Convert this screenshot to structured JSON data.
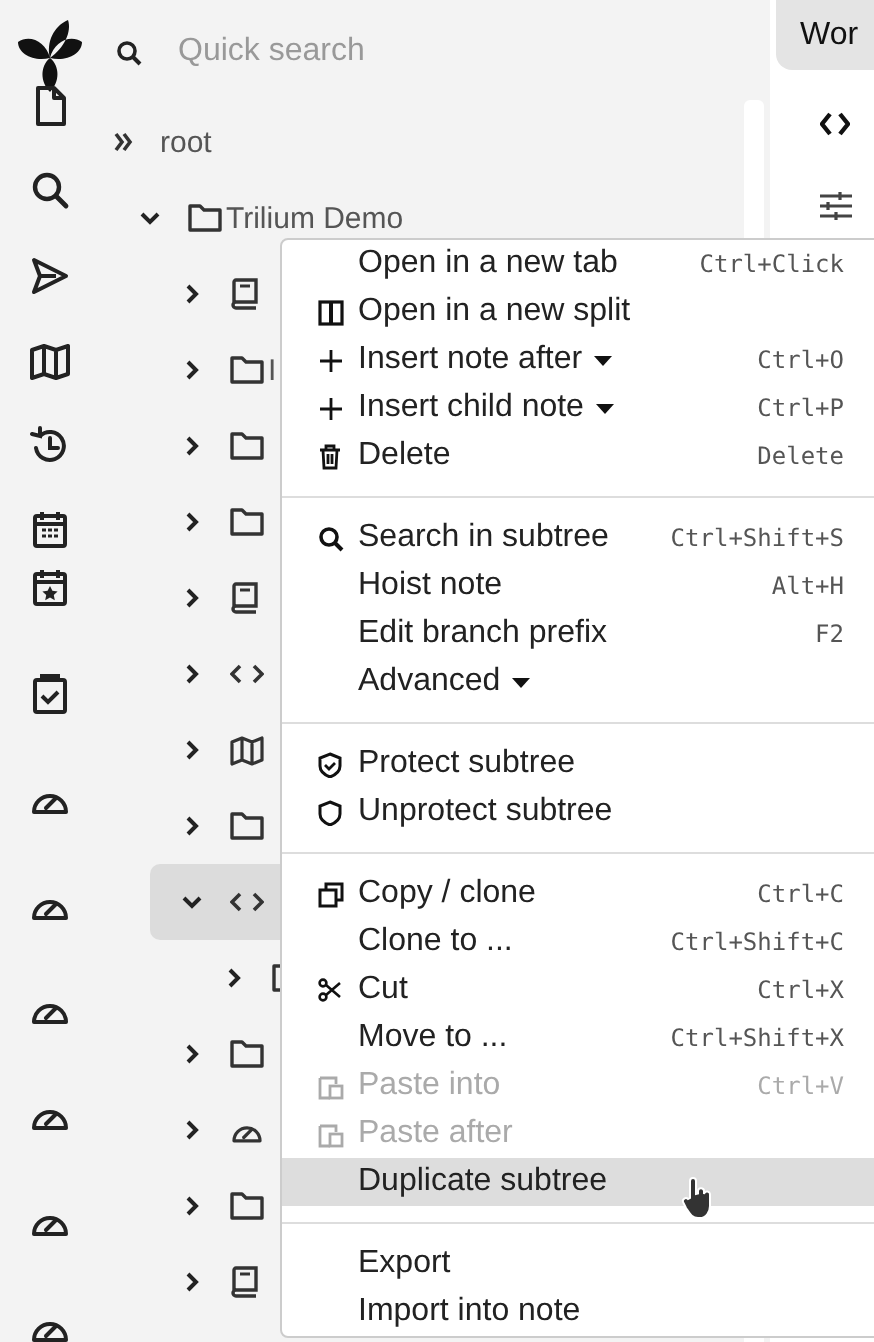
{
  "search": {
    "placeholder": "Quick search"
  },
  "tab": {
    "label": "Wor"
  },
  "tree": [
    {
      "label": "root",
      "selected": false,
      "children": [
        {
          "label": "Trilium Demo",
          "expanded": true,
          "selected": false,
          "children": [
            {
              "expanded": false,
              "selected": false
            },
            {
              "label": "I",
              "expanded": false,
              "selected": false
            },
            {
              "expanded": false,
              "selected": false
            },
            {
              "expanded": false,
              "selected": false
            },
            {
              "expanded": false,
              "selected": false
            },
            {
              "expanded": false,
              "selected": false
            },
            {
              "expanded": false,
              "selected": false
            },
            {
              "expanded": false,
              "selected": false
            },
            {
              "expanded": true,
              "selected": true,
              "children": [
                {
                  "expanded": false,
                  "selected": false
                }
              ]
            },
            {
              "expanded": false,
              "selected": false
            },
            {
              "expanded": false,
              "selected": false
            },
            {
              "expanded": false,
              "selected": false
            },
            {
              "expanded": false,
              "selected": false
            }
          ]
        }
      ]
    }
  ],
  "menu": {
    "groups": [
      [
        {
          "label": "Open in a new tab",
          "shortcut": "Ctrl+Click",
          "submenu": false,
          "disabled": false,
          "highlighted": false
        },
        {
          "label": "Open in a new split",
          "submenu": false,
          "disabled": false,
          "highlighted": false
        },
        {
          "label": "Insert note after",
          "shortcut": "Ctrl+O",
          "submenu": true,
          "disabled": false,
          "highlighted": false
        },
        {
          "label": "Insert child note",
          "shortcut": "Ctrl+P",
          "submenu": true,
          "disabled": false,
          "highlighted": false
        },
        {
          "label": "Delete",
          "shortcut": "Delete",
          "submenu": false,
          "disabled": false,
          "highlighted": false
        }
      ],
      [
        {
          "label": "Search in subtree",
          "shortcut": "Ctrl+Shift+S",
          "submenu": false,
          "disabled": false,
          "highlighted": false
        },
        {
          "label": "Hoist note",
          "shortcut": "Alt+H",
          "submenu": false,
          "disabled": false,
          "highlighted": false
        },
        {
          "label": "Edit branch prefix",
          "shortcut": "F2",
          "submenu": false,
          "disabled": false,
          "highlighted": false
        },
        {
          "label": "Advanced",
          "submenu": true,
          "disabled": false,
          "highlighted": false
        }
      ],
      [
        {
          "label": "Protect subtree",
          "submenu": false,
          "disabled": false,
          "highlighted": false
        },
        {
          "label": "Unprotect subtree",
          "submenu": false,
          "disabled": false,
          "highlighted": false
        }
      ],
      [
        {
          "label": "Copy / clone",
          "shortcut": "Ctrl+C",
          "submenu": false,
          "disabled": false,
          "highlighted": false
        },
        {
          "label": "Clone to ...",
          "shortcut": "Ctrl+Shift+C",
          "submenu": false,
          "disabled": false,
          "highlighted": false
        },
        {
          "label": "Cut",
          "shortcut": "Ctrl+X",
          "submenu": false,
          "disabled": false,
          "highlighted": false
        },
        {
          "label": "Move to ...",
          "shortcut": "Ctrl+Shift+X",
          "submenu": false,
          "disabled": false,
          "highlighted": false
        },
        {
          "label": "Paste into",
          "shortcut": "Ctrl+V",
          "submenu": false,
          "disabled": true,
          "highlighted": false
        },
        {
          "label": "Paste after",
          "submenu": false,
          "disabled": true,
          "highlighted": false
        },
        {
          "label": "Duplicate subtree",
          "submenu": false,
          "disabled": false,
          "highlighted": true
        }
      ],
      [
        {
          "label": "Export",
          "submenu": false,
          "disabled": false,
          "highlighted": false
        },
        {
          "label": "Import into note",
          "submenu": false,
          "disabled": false,
          "highlighted": false
        }
      ]
    ]
  }
}
